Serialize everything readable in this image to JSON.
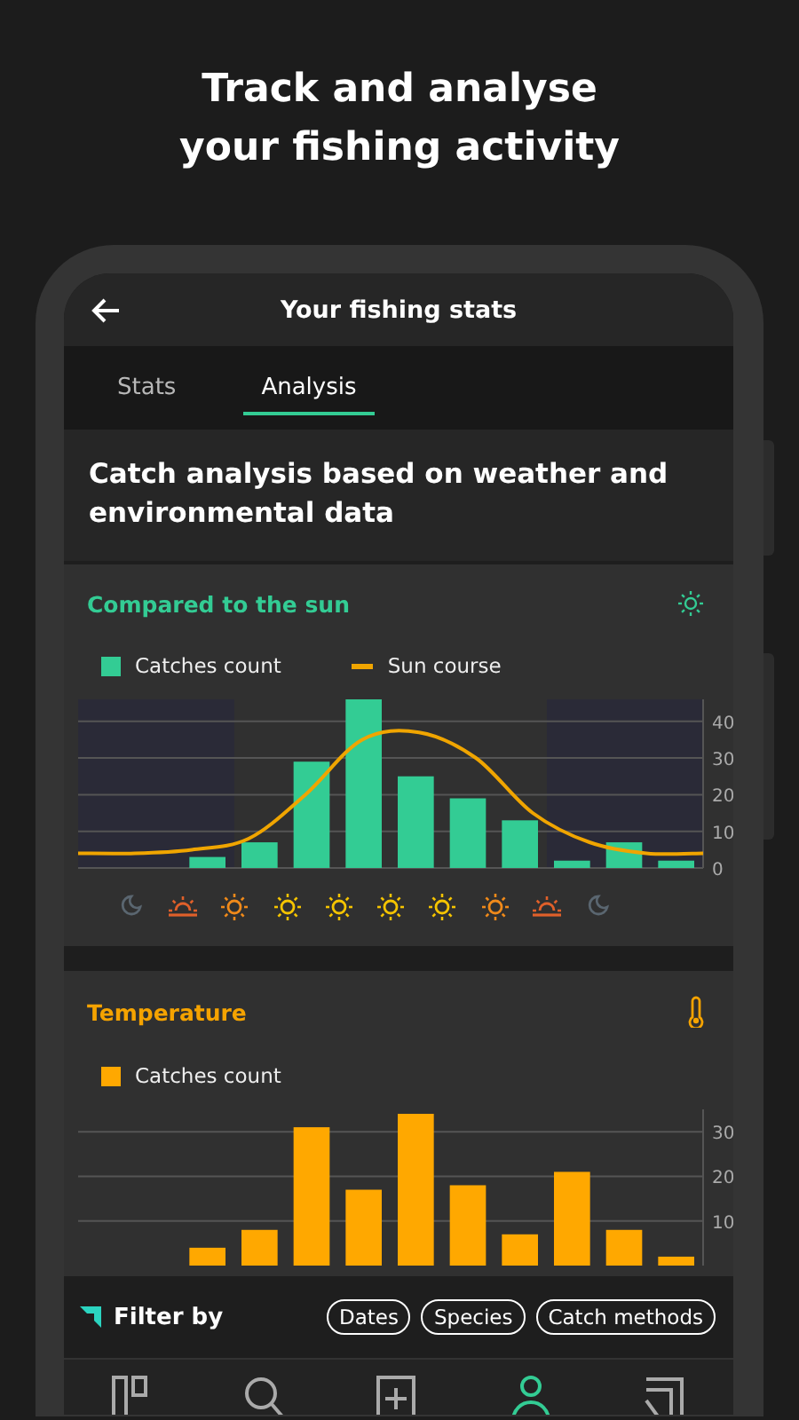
{
  "headline": "Track and analyse your fishing activity",
  "header": {
    "title": "Your fishing stats"
  },
  "tabs": [
    {
      "label": "Stats",
      "selected": false
    },
    {
      "label": "Analysis",
      "selected": true
    }
  ],
  "intro": "Catch analysis based on weather and environmental data",
  "sun_card": {
    "title": "Compared to the sun",
    "chart_data": {
      "type": "bar",
      "grid": true,
      "ylim": [
        0,
        46
      ],
      "yticks": [
        0,
        10,
        20,
        30,
        40
      ],
      "series": [
        {
          "name": "Catches count",
          "color": "#33cc94",
          "values": [
            0,
            0,
            3,
            7,
            29,
            46,
            25,
            19,
            13,
            2,
            7,
            2
          ]
        },
        {
          "name": "Sun course",
          "type": "line",
          "color": "#f0a500",
          "values": [
            4,
            4,
            5,
            8,
            20,
            35,
            37,
            30,
            15,
            7,
            4,
            4
          ]
        }
      ]
    },
    "phases": [
      {
        "kind": "moon"
      },
      {
        "kind": "horizon"
      },
      {
        "kind": "rising"
      },
      {
        "kind": "sun"
      },
      {
        "kind": "sun"
      },
      {
        "kind": "sun"
      },
      {
        "kind": "sun"
      },
      {
        "kind": "setting"
      },
      {
        "kind": "horizon"
      },
      {
        "kind": "moon"
      }
    ]
  },
  "temp_card": {
    "title": "Temperature",
    "chart_data": {
      "type": "bar",
      "grid": true,
      "ylim": [
        0,
        35
      ],
      "yticks": [
        10,
        20,
        30
      ],
      "series": [
        {
          "name": "Catches count",
          "color": "#ffa800",
          "values": [
            0,
            0,
            4,
            8,
            31,
            17,
            34,
            18,
            7,
            21,
            8,
            2
          ]
        }
      ]
    }
  },
  "filter": {
    "label": "Filter by",
    "chips": [
      "Dates",
      "Species",
      "Catch methods"
    ]
  },
  "nav": [
    {
      "kind": "board",
      "selected": false
    },
    {
      "kind": "search",
      "selected": false
    },
    {
      "kind": "add",
      "selected": false
    },
    {
      "kind": "profile",
      "selected": true
    },
    {
      "kind": "feed",
      "selected": false
    }
  ]
}
